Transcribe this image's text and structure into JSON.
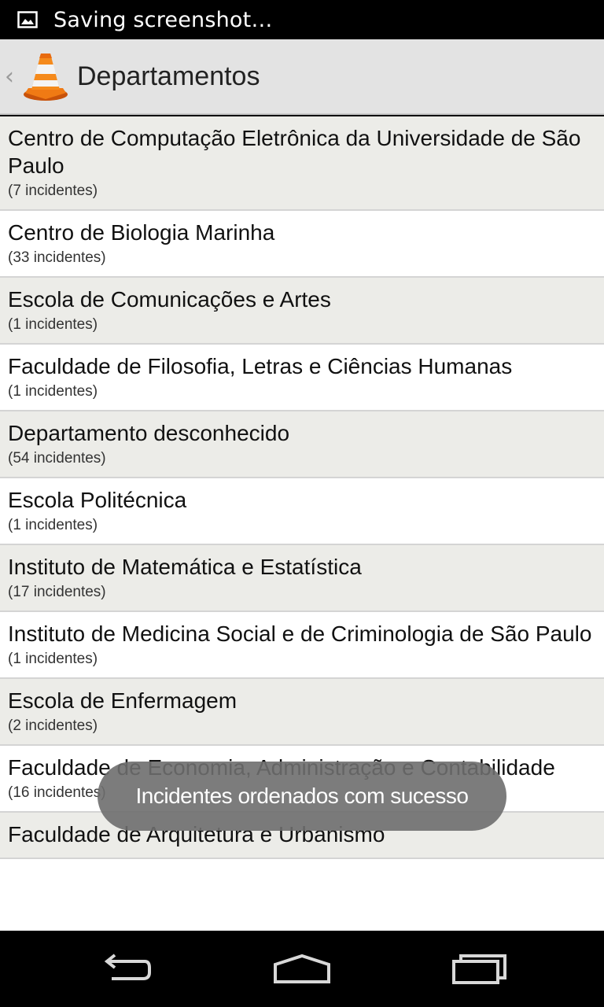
{
  "status_bar": {
    "text": "Saving screenshot…",
    "icon": "image-icon"
  },
  "action_bar": {
    "title": "Departamentos",
    "logo": "traffic-cone-icon",
    "up_icon": "up-caret-icon"
  },
  "departments": [
    {
      "name": "Centro de Computação Eletrônica da Universidade de São Paulo",
      "count": "(7 incidentes)"
    },
    {
      "name": "Centro de Biologia Marinha",
      "count": "(33 incidentes)"
    },
    {
      "name": "Escola de Comunicações e Artes",
      "count": "(1 incidentes)"
    },
    {
      "name": "Faculdade de Filosofia, Letras e Ciências Humanas",
      "count": "(1 incidentes)"
    },
    {
      "name": "Departamento desconhecido",
      "count": "(54 incidentes)"
    },
    {
      "name": "Escola Politécnica",
      "count": "(1 incidentes)"
    },
    {
      "name": "Instituto de Matemática e Estatística",
      "count": "(17 incidentes)"
    },
    {
      "name": "Instituto de Medicina Social e de Criminologia de São Paulo",
      "count": "(1 incidentes)"
    },
    {
      "name": "Escola de Enfermagem",
      "count": "(2 incidentes)"
    },
    {
      "name": "Faculdade de Economia, Administração e Contabilidade",
      "count": "(16 incidentes)"
    },
    {
      "name": "Faculdade de Arquitetura e Urbanismo",
      "count": ""
    }
  ],
  "toast": {
    "message": "Incidentes ordenados com sucesso"
  },
  "nav_bar": {
    "back_icon": "back-icon",
    "home_icon": "home-icon",
    "recents_icon": "recent-apps-icon"
  }
}
